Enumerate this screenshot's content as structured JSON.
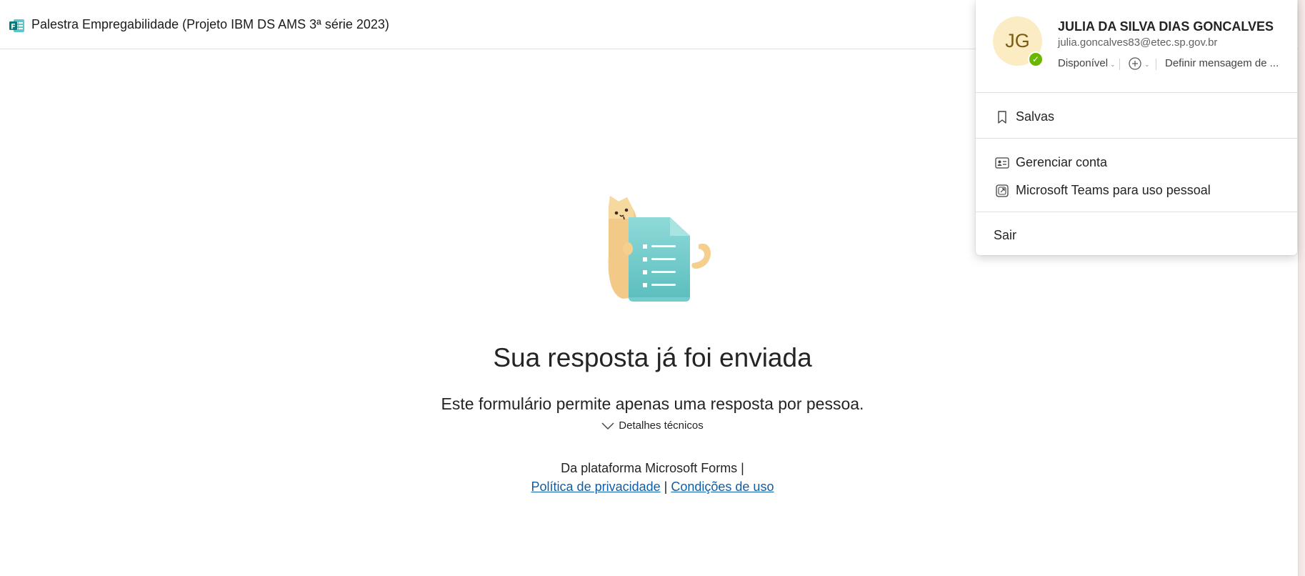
{
  "header": {
    "app_icon": "microsoft-forms-icon",
    "title": "Palestra Empregabilidade (Projeto IBM DS AMS 3ª série 2023)"
  },
  "main": {
    "illustration": "cat-with-form-document",
    "title": "Sua resposta já foi enviada",
    "message": "Este formulário permite apenas uma resposta por pessoa.",
    "details_label": "Detalhes técnicos",
    "footer_platform": "Da plataforma Microsoft Forms |",
    "privacy_link": "Política de privacidade",
    "separator": "|",
    "terms_link": "Condições de uso"
  },
  "account": {
    "initials": "JG",
    "name": "JULIA DA SILVA DIAS GONCALVES",
    "email": "julia.goncalves83@etec.sp.gov.br",
    "presence_status": "Disponível",
    "presence_color": "#6bb700",
    "location_icon": "location-add-icon",
    "status_message": "Definir mensagem de ...",
    "menu": {
      "saved": "Salvas",
      "manage_account": "Gerenciar conta",
      "teams_personal": "Microsoft Teams para uso pessoal",
      "sign_out": "Sair"
    }
  },
  "colors": {
    "link": "#0f5ea8",
    "avatar_bg": "#fbecc3",
    "accent_teal": "#5cc6c8"
  }
}
